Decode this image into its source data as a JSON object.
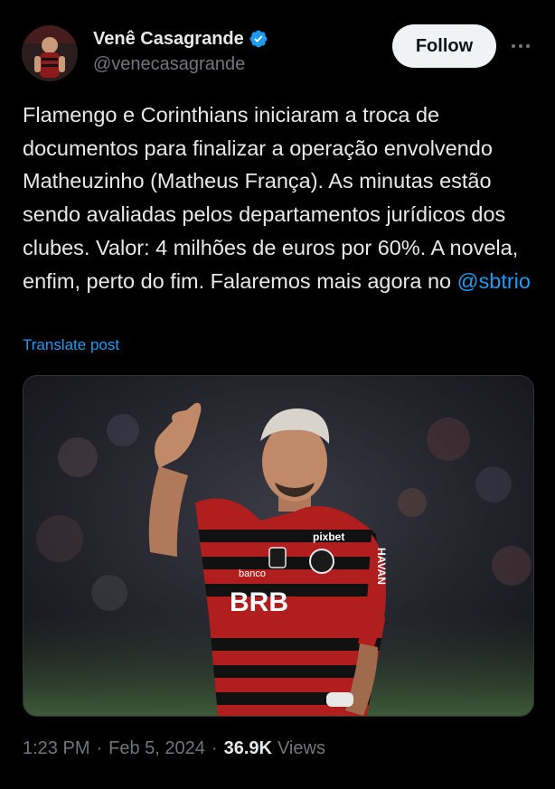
{
  "author": {
    "display_name": "Venê Casagrande",
    "handle": "@venecasagrande",
    "verified": true
  },
  "actions": {
    "follow_label": "Follow",
    "more_icon": "more-horizontal-icon"
  },
  "post": {
    "text_before_mention": "Flamengo e Corinthians iniciaram a troca de documentos para finalizar a operação envolvendo Matheuzinho (Matheus França). As minutas estão sendo avaliadas pelos departamentos jurídicos dos clubes. Valor: 4 milhões de euros por 60%. A novela, enfim, perto do fim. Falaremos mais agora no ",
    "mention": "@sbtrio",
    "translate_label": "Translate post"
  },
  "media": {
    "description_icon": "photo-soccer-player",
    "shirt_texts": {
      "sponsor_main": "BRB",
      "sponsor_small": "banco",
      "sleeve": "HAVAN",
      "chest": "pixbet"
    }
  },
  "meta": {
    "time": "1:23 PM",
    "separator": "·",
    "date": "Feb 5, 2024",
    "views_count": "36.9K",
    "views_label": "Views"
  },
  "colors": {
    "background": "#000000",
    "text": "#e7e9ea",
    "secondary": "#71767b",
    "accent": "#1d9bf0",
    "follow_bg": "#eff3f4"
  }
}
